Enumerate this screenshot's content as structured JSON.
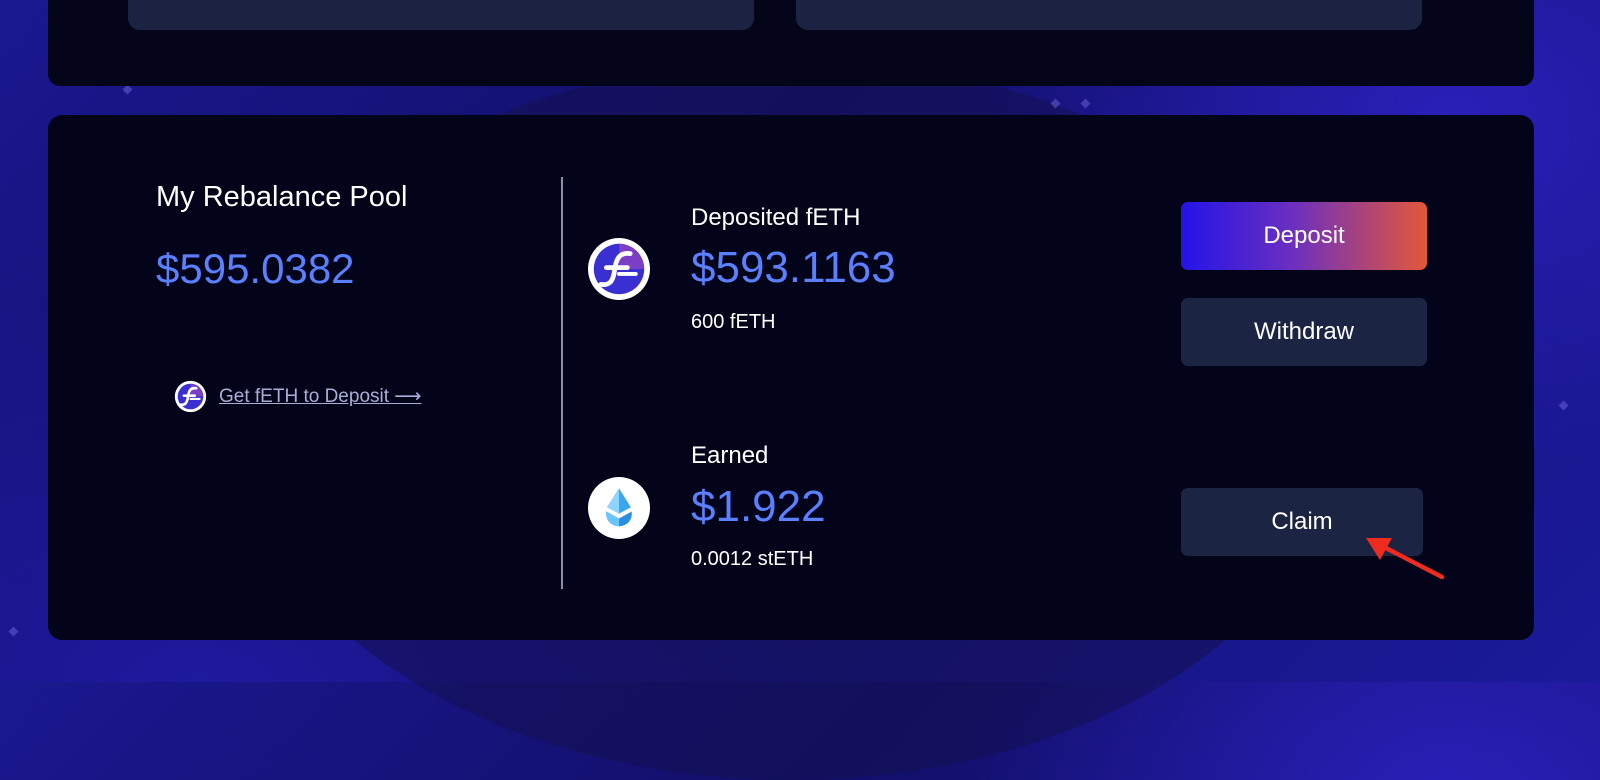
{
  "pool": {
    "title": "My Rebalance Pool",
    "total_value": "$595.0382",
    "get_link": "Get fETH to Deposit ⟶"
  },
  "deposited": {
    "label": "Deposited fETH",
    "value": "$593.1163",
    "amount": "600 fETH",
    "icon": "feth-icon"
  },
  "earned": {
    "label": "Earned",
    "value": "$1.922",
    "amount": "0.0012 stETH",
    "icon": "steth-icon"
  },
  "actions": {
    "deposit_label": "Deposit",
    "withdraw_label": "Withdraw",
    "claim_label": "Claim"
  },
  "colors": {
    "accent_value": "#5b80ff",
    "panel_bg": "#03041a",
    "button_dark": "#1b2442",
    "deposit_gradient_start": "#2313e8",
    "deposit_gradient_end": "#e3573a",
    "annotation_arrow": "#ee2b1f"
  }
}
